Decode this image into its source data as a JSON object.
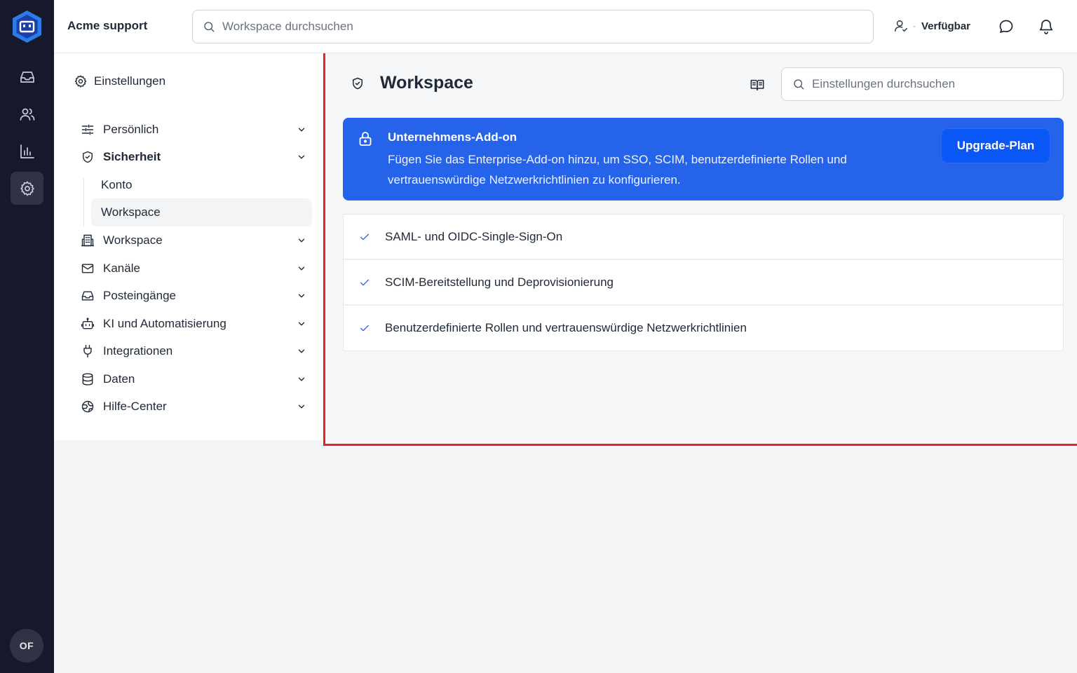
{
  "app": {
    "workspace_name": "Acme support",
    "search_placeholder": "Workspace durchsuchen",
    "status_label": "Verfügbar",
    "status_separator": "·",
    "avatar_initials": "OF"
  },
  "rail": {
    "items": [
      {
        "icon": "inbox-icon",
        "active": false
      },
      {
        "icon": "users-icon",
        "active": false
      },
      {
        "icon": "bar-chart-icon",
        "active": false
      },
      {
        "icon": "gear-icon",
        "active": true
      }
    ]
  },
  "sidebar": {
    "header": "Einstellungen",
    "items": [
      {
        "label": "Persönlich",
        "icon": "sliders-icon"
      },
      {
        "label": "Sicherheit",
        "icon": "shield-icon",
        "expanded": true
      },
      {
        "label": "Workspace",
        "icon": "building-icon"
      },
      {
        "label": "Kanäle",
        "icon": "mail-icon"
      },
      {
        "label": "Posteingänge",
        "icon": "inbox-icon"
      },
      {
        "label": "KI und Automatisierung",
        "icon": "bot-icon"
      },
      {
        "label": "Integrationen",
        "icon": "plug-icon"
      },
      {
        "label": "Daten",
        "icon": "database-icon"
      },
      {
        "label": "Hilfe-Center",
        "icon": "globe-icon"
      }
    ],
    "sub_items": [
      {
        "label": "Konto",
        "active": false
      },
      {
        "label": "Workspace",
        "active": true
      }
    ]
  },
  "main": {
    "title": "Workspace",
    "search_placeholder": "Einstellungen durchsuchen",
    "banner": {
      "title": "Unternehmens-Add-on",
      "description": "Fügen Sie das Enterprise-Add-on hinzu, um SSO, SCIM, benutzerdefinierte Rollen und vertrauenswürdige Netzwerkrichtlinien zu konfigurieren.",
      "button_label": "Upgrade-Plan",
      "color": "#2563eb"
    },
    "features": [
      "SAML- und OIDC-Single-Sign-On",
      "SCIM-Bereitstellung und Deprovisionierung",
      "Benutzerdefinierte Rollen und vertrauenswürdige Netzwerkrichtlinien"
    ]
  }
}
